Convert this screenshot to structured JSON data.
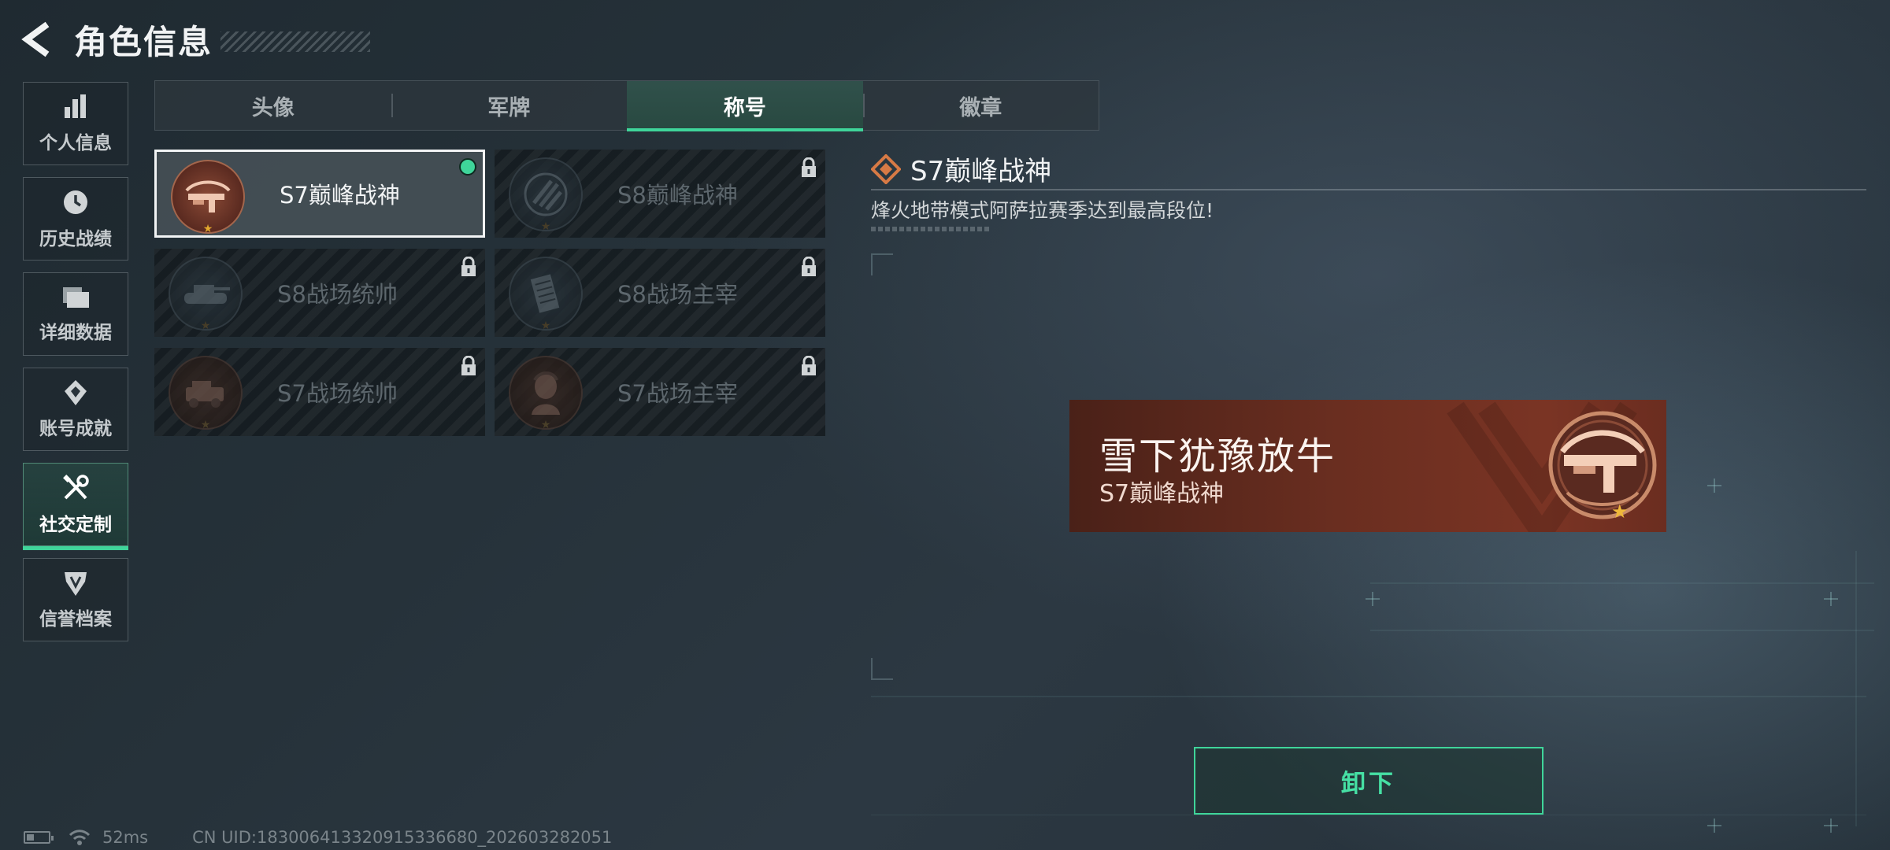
{
  "header": {
    "title": "角色信息"
  },
  "sidebar": {
    "items": [
      {
        "label": "个人信息",
        "icon": "bar-chart-icon",
        "active": false
      },
      {
        "label": "历史战绩",
        "icon": "clock-icon",
        "active": false
      },
      {
        "label": "详细数据",
        "icon": "folder-icon",
        "active": false
      },
      {
        "label": "账号成就",
        "icon": "achievement-icon",
        "active": false
      },
      {
        "label": "社交定制",
        "icon": "tools-icon",
        "active": true
      },
      {
        "label": "信誉档案",
        "icon": "shield-icon",
        "active": false
      }
    ]
  },
  "tabs": [
    {
      "label": "头像",
      "active": false
    },
    {
      "label": "军牌",
      "active": false
    },
    {
      "label": "称号",
      "active": true
    },
    {
      "label": "徽章",
      "active": false
    }
  ],
  "titles": [
    {
      "name": "S7巅峰战神",
      "state": "equipped",
      "icon": "crossbow-emblem-icon"
    },
    {
      "name": "S8巅峰战神",
      "state": "locked",
      "icon": "striped-emblem-icon"
    },
    {
      "name": "S8战场统帅",
      "state": "locked",
      "icon": "tank-emblem-icon"
    },
    {
      "name": "S8战场主宰",
      "state": "locked",
      "icon": "building-emblem-icon"
    },
    {
      "name": "S7战场统帅",
      "state": "locked",
      "icon": "vehicle-emblem-icon"
    },
    {
      "name": "S7战场主宰",
      "state": "locked",
      "icon": "soldier-emblem-icon"
    }
  ],
  "detail": {
    "title": "S7巅峰战神",
    "description": "烽火地带模式阿萨拉赛季达到最高段位!"
  },
  "preview": {
    "player_name": "雪下犹豫放牛",
    "title": "S7巅峰战神"
  },
  "actions": {
    "unequip_label": "卸下"
  },
  "status_bar": {
    "ping": "52ms",
    "uid": "CN UID:18300641332091533668​0_202603282051"
  },
  "colors": {
    "accent": "#3fd59a",
    "plate_bg": "#6a2e20",
    "badge_copper": "#c98b6a"
  }
}
